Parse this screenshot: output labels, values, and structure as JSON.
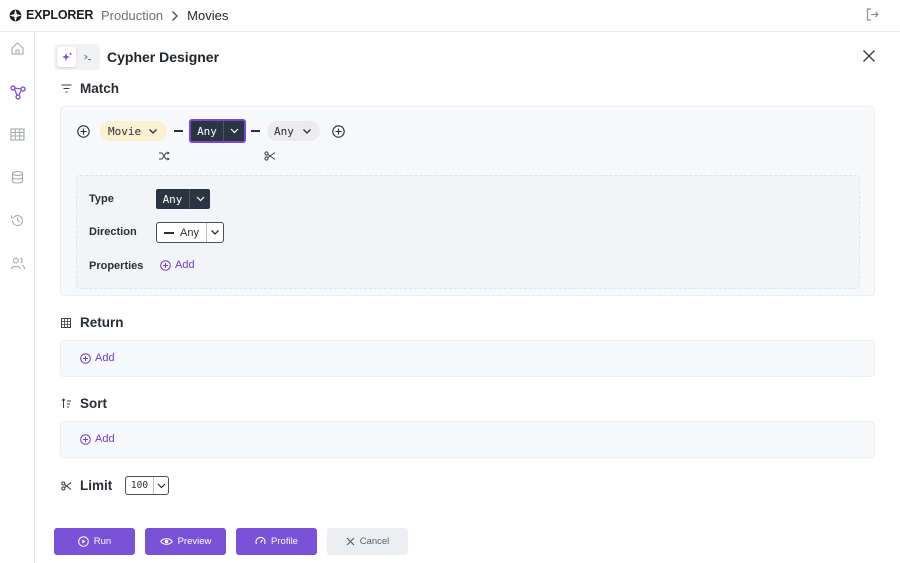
{
  "app": {
    "name": "EXPLORER"
  },
  "breadcrumb": {
    "parent": "Production",
    "current": "Movies"
  },
  "designer": {
    "title": "Cypher Designer"
  },
  "match": {
    "title": "Match",
    "node_left": "Movie",
    "relationship": "Any",
    "node_right": "Any",
    "type_label": "Type",
    "type_value": "Any",
    "direction_label": "Direction",
    "direction_value": "Any",
    "properties_label": "Properties",
    "properties_add": "Add"
  },
  "return_section": {
    "title": "Return",
    "add": "Add"
  },
  "sort_section": {
    "title": "Sort",
    "add": "Add"
  },
  "limit_section": {
    "title": "Limit",
    "value": "100"
  },
  "actions": {
    "run": "Run",
    "preview": "Preview",
    "profile": "Profile",
    "cancel": "Cancel"
  },
  "colors": {
    "accent": "#7a52d8",
    "dark": "#2b3542",
    "node_pill": "#faf0d2"
  },
  "icons": {
    "sidebar": [
      "home-icon",
      "graph-icon",
      "table-icon",
      "database-icon",
      "history-icon",
      "users-icon"
    ]
  }
}
